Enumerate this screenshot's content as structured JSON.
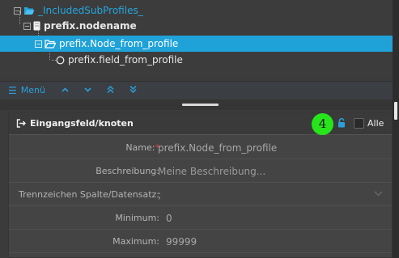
{
  "tree": {
    "items": [
      {
        "label": "_IncludedSubProfiles_",
        "icon": "folder-open-icon",
        "state": "expanded"
      },
      {
        "label": "prefix.nodename",
        "icon": "file-icon",
        "state": "expanded"
      },
      {
        "label": "prefix.Node_from_profile",
        "icon": "folder-open-icon",
        "state": "expanded",
        "selected": true
      },
      {
        "label": "prefix.field_from_profile",
        "icon": "circle-icon"
      }
    ]
  },
  "toolbar": {
    "menu_label": "Menü",
    "buttons": [
      "chevron-up-icon",
      "chevron-down-icon",
      "double-chevron-up-icon",
      "double-chevron-down-icon"
    ]
  },
  "panel": {
    "title": "Eingangsfeld/knoten",
    "badge": "4",
    "all_label": "Alle",
    "all_checked": false
  },
  "form": {
    "name_label": "Name:",
    "name_required_mark": "*",
    "name_value": "prefix.Node_from_profile",
    "description_label": "Beschreibung:",
    "description_placeholder": "Meine Beschreibung...",
    "separator_label": "Trennzeichen Spalte/Datensatz:",
    "separator_value": ";",
    "minimum_label": "Minimum:",
    "minimum_value": "0",
    "maximum_label": "Maximum:",
    "maximum_value": "99999"
  },
  "colors": {
    "selection": "#1fa2d8",
    "accent": "#2a9fd8",
    "badge": "#26e51a",
    "required": "#e03a3a"
  }
}
